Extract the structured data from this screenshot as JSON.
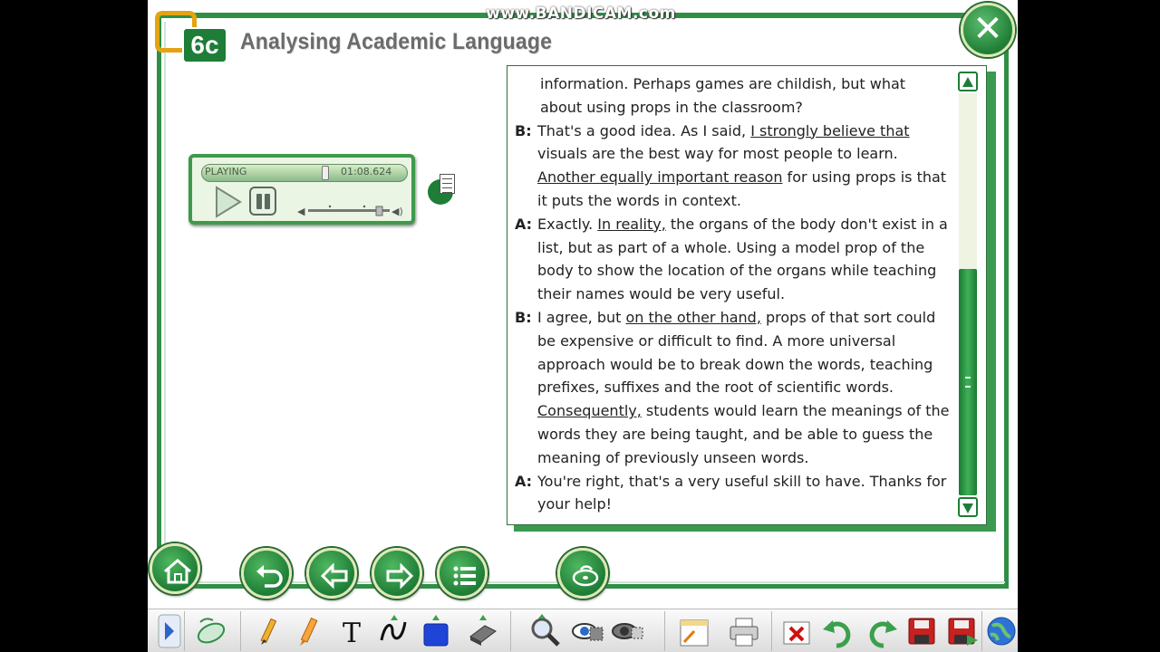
{
  "watermark": "www.BANDICAM.com",
  "header": {
    "unit": "6c",
    "title": "Analysing Academic Language"
  },
  "player": {
    "status": "PLAYING",
    "time": "01:08.624",
    "progress": 0.6,
    "volume": 0.85
  },
  "dialog": [
    {
      "speaker": "",
      "parts": [
        [
          "information. Perhaps games are childish, but what about using props in the classroom?",
          false
        ]
      ]
    },
    {
      "speaker": "B:",
      "parts": [
        [
          "That's a good idea. As I said, ",
          false
        ],
        [
          "I strongly believe that",
          true
        ],
        [
          " visuals are the best way for most people to learn. ",
          false
        ],
        [
          "Another equally important reason",
          true
        ],
        [
          " for using props is that it puts the words in context.",
          false
        ]
      ]
    },
    {
      "speaker": "A:",
      "parts": [
        [
          "Exactly. ",
          false
        ],
        [
          "In reality,",
          true
        ],
        [
          " the organs of the body don't exist in a list, but as part of a whole. Using a model prop of the body to show the location of the organs while teaching their names would be very useful.",
          false
        ]
      ]
    },
    {
      "speaker": "B:",
      "parts": [
        [
          "I agree, but ",
          false
        ],
        [
          "on the other hand,",
          true
        ],
        [
          " props of that sort could be expensive or difficult to find. A more universal approach would be to break down the words, teaching prefixes, suffixes and the root of scientific words. ",
          false
        ],
        [
          "Consequently,",
          true
        ],
        [
          " students would learn the meanings of the words they are being taught, and be able to guess the meaning of previously unseen words.",
          false
        ]
      ]
    },
    {
      "speaker": "A:",
      "parts": [
        [
          "You're right, that's a very useful skill to have. Thanks for your help!",
          false
        ]
      ]
    }
  ],
  "colors": {
    "frame": "#2f8f45",
    "button": "#1e7d36",
    "badge_ring": "#e4a312",
    "title": "#6b6b6b"
  },
  "nav_icons": [
    "home-icon",
    "undo-icon",
    "arrow-left-icon",
    "arrow-right-icon",
    "list-icon",
    "audio-cd-icon"
  ],
  "toolbar_icons": [
    "expand-arrow-icon",
    "mouse-icon",
    "pencil-icon",
    "highlighter-icon",
    "text-icon",
    "freehand-icon",
    "shape-icon",
    "eraser-icon",
    "zoom-icon",
    "reveal-icon",
    "hide-icon",
    "note-icon",
    "print-icon",
    "clear-icon",
    "undo-icon",
    "redo-icon",
    "save-icon",
    "save-as-icon",
    "web-icon"
  ]
}
